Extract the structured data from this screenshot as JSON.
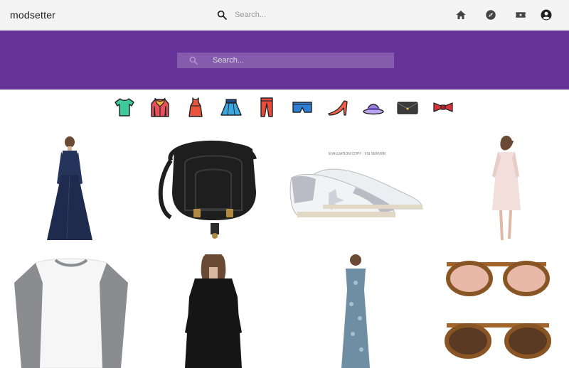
{
  "app": {
    "title": "modsetter"
  },
  "header": {
    "search_placeholder": "Search...",
    "nav": [
      {
        "name": "home-icon"
      },
      {
        "name": "explore-compass-icon"
      },
      {
        "name": "ticket-icon"
      },
      {
        "name": "account-circle-icon"
      }
    ]
  },
  "hero": {
    "search_placeholder": "Search..."
  },
  "categories": [
    {
      "name": "tshirt-icon",
      "color": "#3ec99a"
    },
    {
      "name": "jacket-icon",
      "color": "#e8505b"
    },
    {
      "name": "dress-icon",
      "color": "#e8553e"
    },
    {
      "name": "skirt-icon",
      "color": "#3ba7e0"
    },
    {
      "name": "pants-icon",
      "color": "#e84a3c"
    },
    {
      "name": "shorts-icon",
      "color": "#2f7fd6"
    },
    {
      "name": "heels-icon",
      "color": "#f0634a"
    },
    {
      "name": "hat-icon",
      "color": "#9b7fe0"
    },
    {
      "name": "clutch-icon",
      "color": "#3a3a3a"
    },
    {
      "name": "bowtie-icon",
      "color": "#d8333a"
    }
  ],
  "products": [
    {
      "name": "navy-gown-image",
      "color": "#1f2b4e"
    },
    {
      "name": "black-saddle-bag-image",
      "color": "#1e1e1e"
    },
    {
      "name": "glitter-sneakers-image",
      "color": "#b9bcc4",
      "watermark": "EVALUATION COPY : FSI SERVER"
    },
    {
      "name": "pink-dress-image",
      "color": "#f2dedb"
    },
    {
      "name": "raglan-tee-image",
      "color": "#8a8c90"
    },
    {
      "name": "black-sweater-image",
      "color": "#151515"
    },
    {
      "name": "printed-maxi-dress-image",
      "color": "#6d8ea3"
    },
    {
      "name": "round-sunglasses-image",
      "color": "#a1652c"
    }
  ]
}
